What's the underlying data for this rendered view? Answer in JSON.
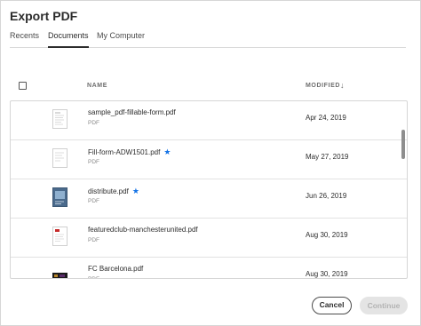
{
  "dialog": {
    "title": "Export PDF"
  },
  "tabs": [
    {
      "label": "Recents",
      "active": false
    },
    {
      "label": "Documents",
      "active": true
    },
    {
      "label": "My Computer",
      "active": false
    }
  ],
  "table": {
    "col_name": "NAME",
    "col_modified": "MODIFIED",
    "sort_icon": "arrow-down-icon",
    "rows": [
      {
        "name": "sample_pdf-fillable-form.pdf",
        "type": "PDF",
        "modified": "Apr 24, 2019",
        "starred": false
      },
      {
        "name": "Fill-form-ADW1501.pdf",
        "type": "PDF",
        "modified": "May 27, 2019",
        "starred": true
      },
      {
        "name": "distribute.pdf",
        "type": "PDF",
        "modified": "Jun 26, 2019",
        "starred": true
      },
      {
        "name": "featuredclub-manchesterunited.pdf",
        "type": "PDF",
        "modified": "Aug 30, 2019",
        "starred": false
      },
      {
        "name": "FC Barcelona.pdf",
        "type": "PDF",
        "modified": "Aug 30, 2019",
        "starred": false
      }
    ]
  },
  "buttons": {
    "cancel": "Cancel",
    "continue": "Continue"
  },
  "colors": {
    "star": "#1473e6",
    "continue_disabled_bg": "#e4e4e4"
  }
}
